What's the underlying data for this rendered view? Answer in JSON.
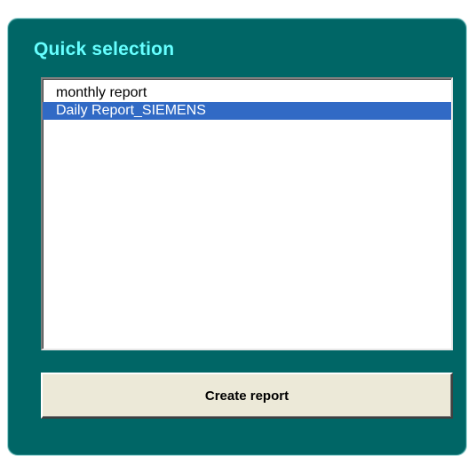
{
  "panel": {
    "title": "Quick selection"
  },
  "report_list": {
    "items": [
      {
        "label": "monthly report",
        "selected": false
      },
      {
        "label": "Daily Report_SIEMENS",
        "selected": true
      }
    ]
  },
  "actions": {
    "create_label": "Create report"
  },
  "colors": {
    "panel_background": "#006666",
    "title_text": "#66ffff",
    "selection_background": "#316ac5",
    "button_face": "#ece9d8"
  }
}
